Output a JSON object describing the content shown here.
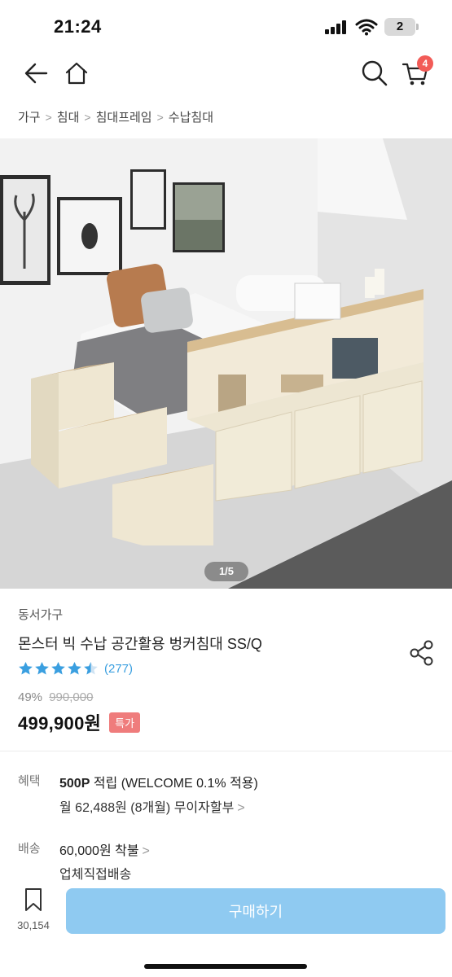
{
  "status_bar": {
    "time": "21:24",
    "battery": "2"
  },
  "header": {
    "cart_count": "4"
  },
  "breadcrumb": [
    "가구",
    "침대",
    "침대프레임",
    "수납침대"
  ],
  "gallery": {
    "counter": "1/5"
  },
  "product": {
    "brand": "동서가구",
    "title": "몬스터 빅 수납 공간활용 벙커침대 SS/Q",
    "rating": 4.5,
    "review_count": "(277)",
    "discount": "49%",
    "original_price": "990,000",
    "price": "499,900원",
    "badge": "특가"
  },
  "benefit": {
    "label": "혜택",
    "points": "500P",
    "points_rest": " 적립 (WELCOME 0.1% 적용)",
    "installment": "월 62,488원 (8개월) 무이자할부"
  },
  "shipping": {
    "label": "배송",
    "fee": "60,000원 착불",
    "method": "업체직접배송"
  },
  "bottom_bar": {
    "wishlist_count": "30,154",
    "buy_label": "구매하기"
  },
  "colors": {
    "accent": "#8fcaf1",
    "badge": "#ef7c7c",
    "cart_badge": "#f25b57",
    "star": "#3a9fe0"
  }
}
